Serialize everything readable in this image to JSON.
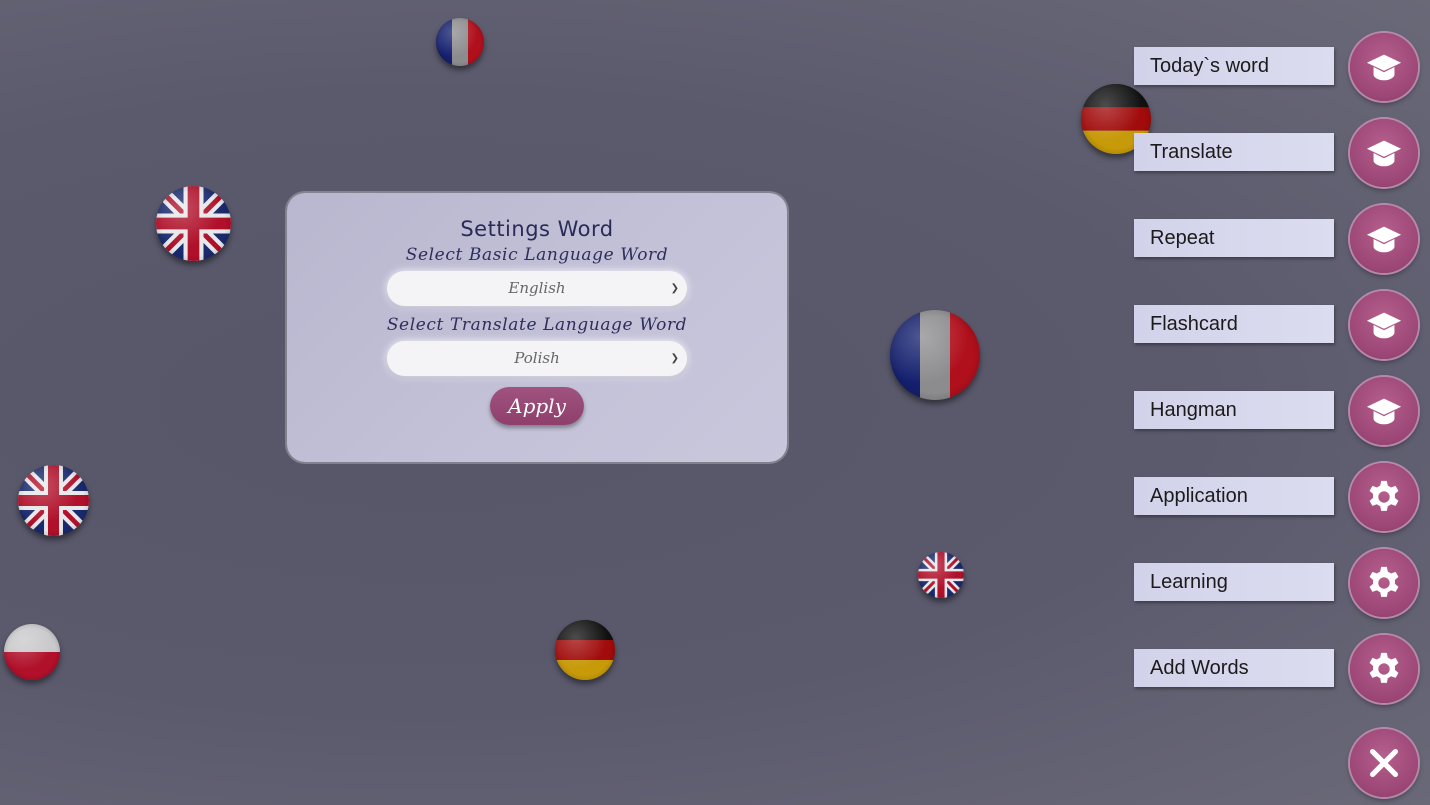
{
  "settings": {
    "title": "Settings Word",
    "basic_label": "Select Basic Language Word",
    "basic_value": "English",
    "translate_label": "Select Translate Language Word",
    "translate_value": "Polish",
    "apply_label": "Apply"
  },
  "menu": {
    "items": [
      {
        "label": "Today`s word",
        "icon": "graduation-cap-icon"
      },
      {
        "label": "Translate",
        "icon": "graduation-cap-icon"
      },
      {
        "label": "Repeat",
        "icon": "graduation-cap-icon"
      },
      {
        "label": "Flashcard",
        "icon": "graduation-cap-icon"
      },
      {
        "label": "Hangman",
        "icon": "graduation-cap-icon"
      },
      {
        "label": "Application",
        "icon": "gear-icon"
      },
      {
        "label": "Learning",
        "icon": "gear-icon"
      },
      {
        "label": "Add Words",
        "icon": "gear-icon"
      }
    ],
    "close_icon": "close-icon"
  },
  "decor": {
    "flags": [
      "france-flag-icon",
      "germany-flag-icon",
      "uk-flag-icon",
      "france-flag-icon",
      "uk-flag-icon",
      "uk-flag-icon",
      "poland-flag-icon",
      "germany-flag-icon"
    ]
  },
  "colors": {
    "background": "#5b5a6d",
    "panel": "#c4c2d8",
    "accent": "#9b4675",
    "menu_label_bg": "#d6d6ee"
  }
}
